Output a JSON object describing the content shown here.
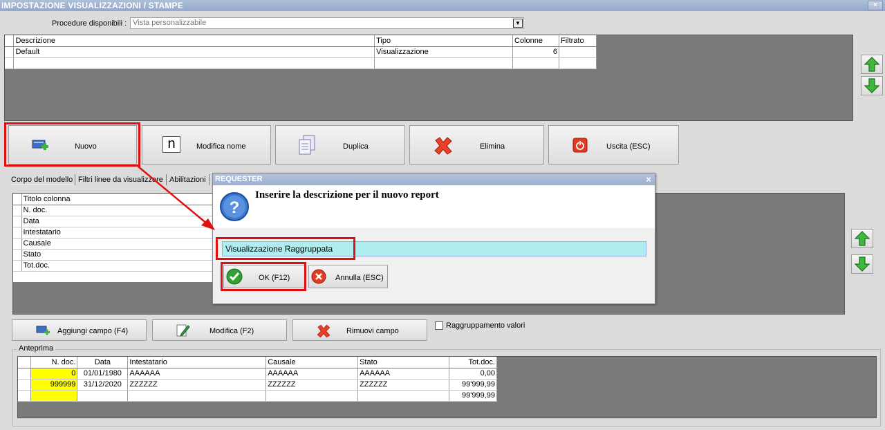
{
  "window": {
    "title": "IMPOSTAZIONE VISUALIZZAZIONI / STAMPE",
    "close": "×"
  },
  "procedure": {
    "label": "Procedure disponibili :",
    "value": "Vista personalizzabile"
  },
  "reports_table": {
    "headers": [
      "Descrizione",
      "Tipo",
      "Colonne",
      "Filtrato"
    ],
    "rows": [
      [
        "Default",
        "Visualizzazione",
        "6",
        ""
      ],
      [
        "",
        "",
        "",
        ""
      ]
    ]
  },
  "toolbar": {
    "new": "Nuovo",
    "rename": "Modifica nome",
    "rename_icon_glyph": "n",
    "duplicate": "Duplica",
    "delete": "Elimina",
    "exit": "Uscita (ESC)"
  },
  "tabs": [
    "Corpo del modello",
    "Filtri linee da visualizzare",
    "Abilitazioni"
  ],
  "columns_table": {
    "header": "Titolo colonna",
    "rows": [
      "N. doc.",
      "Data",
      "Intestatario",
      "Causale",
      "Stato",
      "Tot.doc."
    ]
  },
  "field_buttons": {
    "add": "Aggiungi campo (F4)",
    "edit": "Modifica (F2)",
    "remove": "Rimuovi campo"
  },
  "grouping": {
    "label": "Raggruppamento valori",
    "checked": false
  },
  "preview": {
    "label": "Anteprima",
    "headers": [
      "N. doc.",
      "Data",
      "Intestatario",
      "Causale",
      "Stato",
      "Tot.doc."
    ],
    "rows": [
      [
        "0",
        "01/01/1980",
        "AAAAAA",
        "AAAAAA",
        "AAAAAA",
        "0,00"
      ],
      [
        "999999",
        "31/12/2020",
        "ZZZZZZ",
        "ZZZZZZ",
        "ZZZZZZ",
        "99'999,99"
      ],
      [
        "",
        "",
        "",
        "",
        "",
        "99'999,99"
      ]
    ]
  },
  "dialog": {
    "title": "REQUESTER",
    "close": "×",
    "message": "Inserire la descrizione per il nuovo report",
    "input_value": "Visualizzazione Raggruppata",
    "ok": "OK (F12)",
    "cancel": "Annulla (ESC)"
  },
  "colors": {
    "highlight": "#e01010",
    "input_bg": "#aeeef0",
    "preview_key_col": "#ffff00"
  },
  "icons": [
    "add-record-icon",
    "rename-n-icon",
    "duplicate-document-icon",
    "delete-x-icon",
    "power-exit-icon",
    "arrow-up-icon",
    "arrow-down-icon",
    "question-icon",
    "ok-check-icon",
    "cancel-x-icon",
    "add-field-icon",
    "edit-pencil-icon",
    "remove-x-icon"
  ]
}
